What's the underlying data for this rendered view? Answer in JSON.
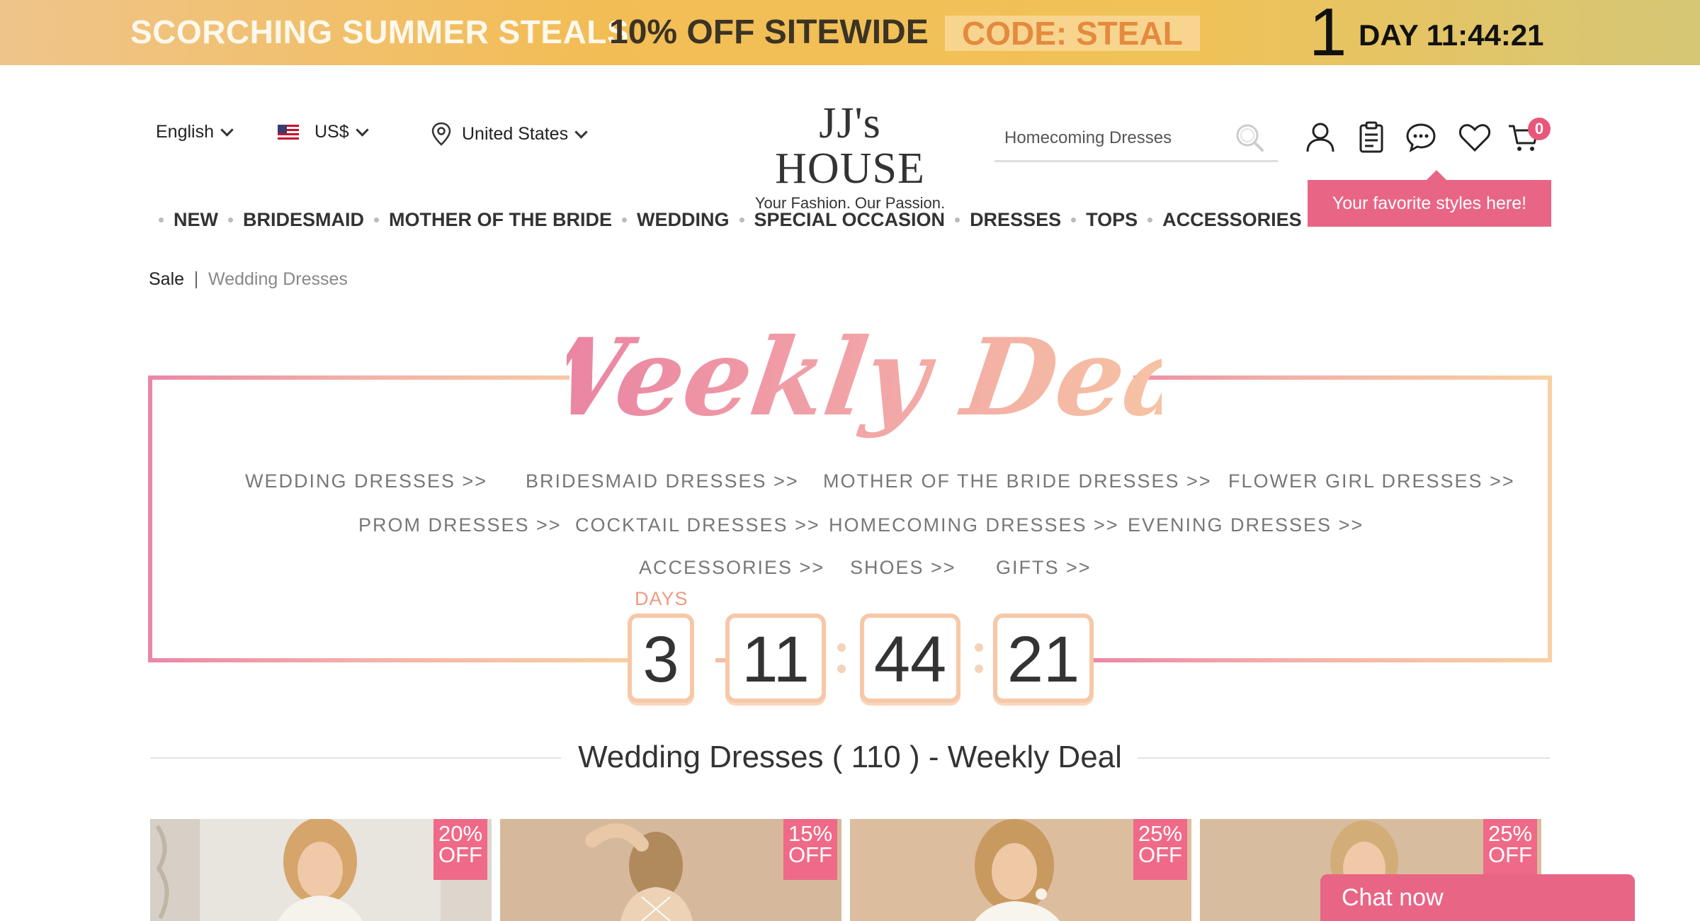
{
  "promo": {
    "headline": "SCORCHING SUMMER STEALS",
    "offer": "10% OFF SITEWIDE",
    "code": "CODE: STEAL",
    "day_number": "1",
    "countdown": "DAY 11:44:21"
  },
  "header": {
    "language": "English",
    "currency": "US$",
    "country": "United States",
    "logo_title": "JJ's HOUSE",
    "logo_tagline": "Your Fashion. Our Passion.",
    "search_placeholder": "Homecoming Dresses",
    "cart_count": "0",
    "tooltip": "Your favorite styles here!"
  },
  "nav": {
    "items": [
      "NEW",
      "BRIDESMAID",
      "MOTHER OF THE BRIDE",
      "WEDDING",
      "SPECIAL OCCASION",
      "DRESSES",
      "TOPS",
      "ACCESSORIES & JEWELRY"
    ]
  },
  "breadcrumb": {
    "root": "Sale",
    "current": "Wedding Dresses"
  },
  "deal": {
    "title": "Weekly Deal",
    "categories": [
      "WEDDING DRESSES >>",
      "BRIDESMAID DRESSES >>",
      "MOTHER OF THE BRIDE DRESSES >>",
      "FLOWER GIRL DRESSES >>",
      "PROM DRESSES >>",
      "COCKTAIL DRESSES >>",
      "HOMECOMING DRESSES >>",
      "EVENING DRESSES >>",
      "ACCESSORIES >>",
      "SHOES >>",
      "GIFTS >>"
    ],
    "days_label": "DAYS",
    "days": "3",
    "hours": "11",
    "minutes": "44",
    "seconds": "21"
  },
  "section_title": "Wedding Dresses ( 110 ) - Weekly Deal",
  "products": [
    {
      "discount": "20%",
      "off": "OFF"
    },
    {
      "discount": "15%",
      "off": "OFF"
    },
    {
      "discount": "25%",
      "off": "OFF"
    },
    {
      "discount": "25%",
      "off": "OFF"
    }
  ],
  "chat": {
    "label": "Chat now"
  },
  "colors": {
    "brand_pink": "#e96585",
    "promo_gold": "#f2bd55",
    "deal_peach": "#f6c8a8"
  }
}
